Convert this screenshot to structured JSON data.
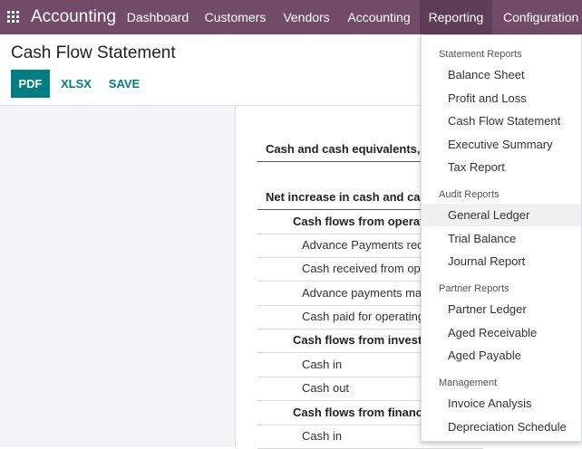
{
  "navbar": {
    "brand": "Accounting",
    "items": [
      {
        "label": "Dashboard"
      },
      {
        "label": "Customers"
      },
      {
        "label": "Vendors"
      },
      {
        "label": "Accounting"
      },
      {
        "label": "Reporting",
        "active": true
      },
      {
        "label": "Configuration"
      }
    ]
  },
  "page": {
    "title": "Cash Flow Statement",
    "buttons": {
      "pdf": "PDF",
      "xlsx": "XLSX",
      "save": "SAVE"
    }
  },
  "report": {
    "rows": [
      {
        "label": "Cash and cash equivalents, b"
      },
      {
        "label": "Net increase in cash and cas"
      },
      {
        "label": "Cash flows from operat"
      },
      {
        "label": "Advance Payments rece"
      },
      {
        "label": "Cash received from ope"
      },
      {
        "label": "Advance payments ma"
      },
      {
        "label": "Cash paid for operating"
      },
      {
        "label": "Cash flows from investi"
      },
      {
        "label": "Cash in"
      },
      {
        "label": "Cash out"
      },
      {
        "label": "Cash flows from financ"
      },
      {
        "label": "Cash in"
      }
    ]
  },
  "dropdown": {
    "sections": [
      {
        "header": "Statement Reports",
        "items": [
          "Balance Sheet",
          "Profit and Loss",
          "Cash Flow Statement",
          "Executive Summary",
          "Tax Report"
        ]
      },
      {
        "header": "Audit Reports",
        "items": [
          "General Ledger",
          "Trial Balance",
          "Journal Report"
        ]
      },
      {
        "header": "Partner Reports",
        "items": [
          "Partner Ledger",
          "Aged Receivable",
          "Aged Payable"
        ]
      },
      {
        "header": "Management",
        "items": [
          "Invoice Analysis",
          "Depreciation Schedule"
        ]
      }
    ]
  }
}
